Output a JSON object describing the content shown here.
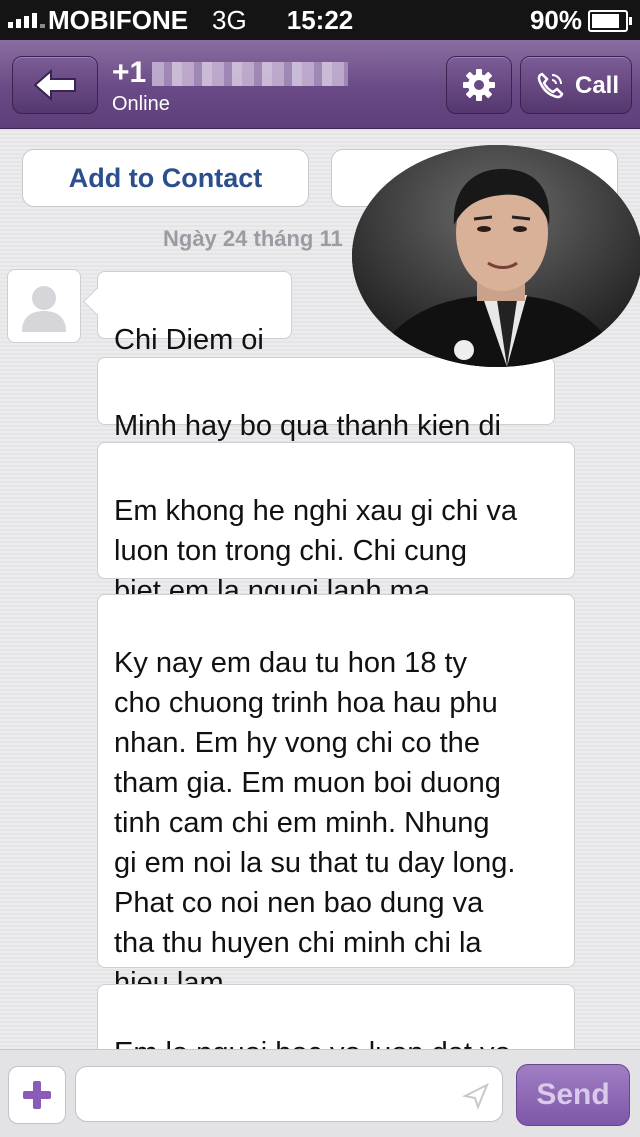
{
  "status_bar": {
    "carrier": "MOBIFONE",
    "network": "3G",
    "time": "15:22",
    "battery_percent": "90%",
    "battery_level": 0.9,
    "signal_icon": "signal-bars-icon",
    "battery_icon": "battery-icon"
  },
  "header": {
    "back_icon": "back-arrow-icon",
    "phone_prefix": "+1",
    "status": "Online",
    "settings_icon": "gear-icon",
    "call_icon": "phone-icon",
    "call_label": "Call",
    "accent_color": "#6a4a86"
  },
  "chat": {
    "add_contact_label": "Add to Contact",
    "date_label": "Ngày 24 tháng 11",
    "messages": [
      {
        "text": "Chi Diem oi"
      },
      {
        "text": "Minh hay bo qua thanh kien di"
      },
      {
        "text": "Em khong he nghi xau gi chi va\nluon ton trong chi.  Chi cung\nbiet em la nguoi lanh ma."
      },
      {
        "text": "Ky nay em dau tu hon 18 ty\ncho chuong trinh hoa hau phu\nnhan.  Em hy vong chi co the\ntham gia.  Em muon boi duong\ntinh cam chi em minh.  Nhung\ngi em noi la su that tu day long.\nPhat co noi nen bao dung va\ntha thu huyen chi minh chi la\nhieu lam."
      },
      {
        "text": "Em la nguoi hoc vo luon dat vo\nduc hang dau.  Em khong bao"
      }
    ]
  },
  "composer": {
    "add_icon": "plus-icon",
    "input_value": "",
    "input_placeholder": "",
    "send_icon": "paper-plane-icon",
    "send_label": "Send"
  }
}
